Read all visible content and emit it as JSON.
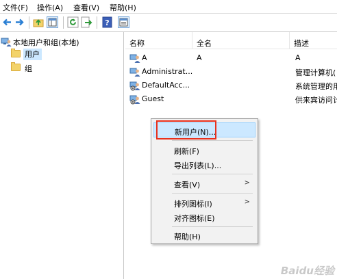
{
  "menubar": {
    "file": "文件(F)",
    "action": "操作(A)",
    "view": "查看(V)",
    "help": "帮助(H)"
  },
  "toolbar": {
    "icons": [
      "back-arrow-icon",
      "forward-arrow-icon",
      "up-folder-icon",
      "show-tree-icon",
      "refresh-icon",
      "export-list-icon",
      "help-icon",
      "properties-icon"
    ]
  },
  "tree": {
    "root": "本地用户和组(本地)",
    "items": [
      {
        "label": "用户",
        "selected": true
      },
      {
        "label": "组",
        "selected": false
      }
    ]
  },
  "list": {
    "columns": [
      "名称",
      "全名",
      "描述"
    ],
    "rows": [
      {
        "name": "A",
        "fullname": "A",
        "desc": "A"
      },
      {
        "name": "Administrat...",
        "fullname": "",
        "desc": "管理计算机("
      },
      {
        "name": "DefaultAcc...",
        "fullname": "",
        "desc": "系统管理的用"
      },
      {
        "name": "Guest",
        "fullname": "",
        "desc": "供来宾访问计"
      }
    ]
  },
  "context_menu": {
    "new_user": "新用户(N)...",
    "refresh": "刷新(F)",
    "export": "导出列表(L)...",
    "view": "查看(V)",
    "arrange": "排列图标(I)",
    "align": "对齐图标(E)",
    "help": "帮助(H)"
  },
  "watermark": "Baidu经验",
  "colors": {
    "highlight": "#cce8ff",
    "red_box": "#e8301c",
    "folder": "#f3d36b"
  }
}
